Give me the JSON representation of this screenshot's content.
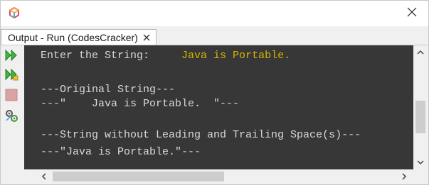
{
  "window": {
    "app_icon": "netbeans-cube-icon",
    "close_icon": "close-icon"
  },
  "tab": {
    "label": "Output - Run (CodesCracker)",
    "close_icon": "tab-close-icon"
  },
  "toolbar": {
    "buttons": [
      {
        "name": "rerun-icon",
        "color": "#2e9e2e"
      },
      {
        "name": "rerun-with-options-icon",
        "color": "#2e9e2e"
      },
      {
        "name": "stop-icon",
        "color": "#c98989"
      },
      {
        "name": "settings-icon",
        "color": "#4a8f3a"
      }
    ]
  },
  "console": {
    "prompt": "Enter the String:     ",
    "user_input": "Java is Portable.",
    "line_original_header": "---Original String---",
    "line_original_value": "---\"    Java is Portable.  \"---",
    "line_trimmed_header": "---String without Leading and Trailing Space(s)---",
    "line_trimmed_value": "---\"Java is Portable.\"---",
    "colors": {
      "background": "#373737",
      "text": "#d9d9d9",
      "input": "#d6b400"
    }
  }
}
